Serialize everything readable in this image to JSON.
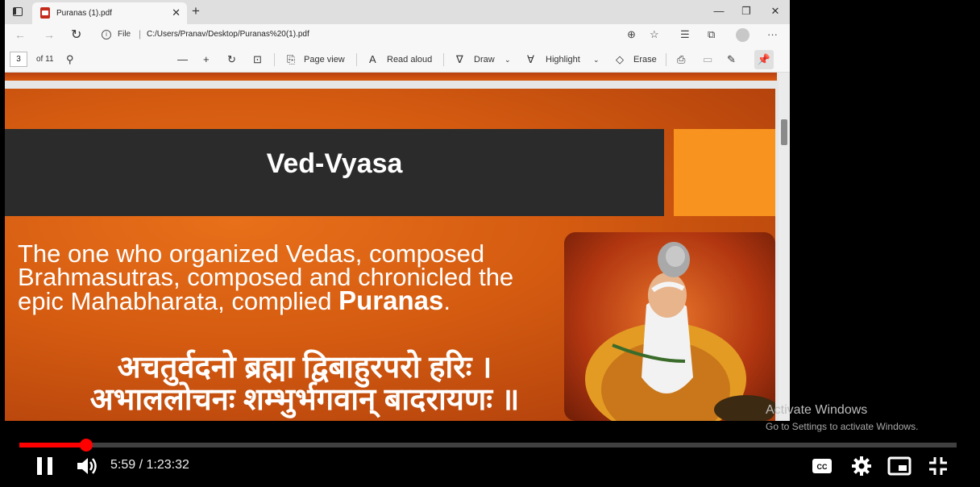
{
  "browser": {
    "tab": {
      "title": "Puranas (1).pdf"
    },
    "address": {
      "scheme_label": "File",
      "url": "C:/Users/Pranav/Desktop/Puranas%20(1).pdf"
    },
    "pdf_toolbar": {
      "page_number": "3",
      "page_total": "of 11",
      "page_view": "Page view",
      "read_aloud": "Read aloud",
      "draw": "Draw",
      "highlight": "Highlight",
      "erase": "Erase"
    }
  },
  "slide": {
    "title": "Ved-Vyasa",
    "body": "The one who organized Vedas, composed Brahmasutras, composed and chronicled the epic Mahabharata, complied ",
    "body_bold": "Puranas",
    "body_end": ".",
    "sanskrit_line1": "अचतुर्वदनो ब्रह्मा द्विबाहुरपरो हरिः ।",
    "sanskrit_line2": "अभाललोचनः शम्भुर्भगवान् बादरायणः ॥"
  },
  "watermark": {
    "title": "Activate Windows",
    "subtitle": "Go to Settings to activate Windows."
  },
  "player": {
    "time": "5:59 / 1:23:32",
    "progress_fraction": 0.0717,
    "accent_color": "#ff0000"
  }
}
